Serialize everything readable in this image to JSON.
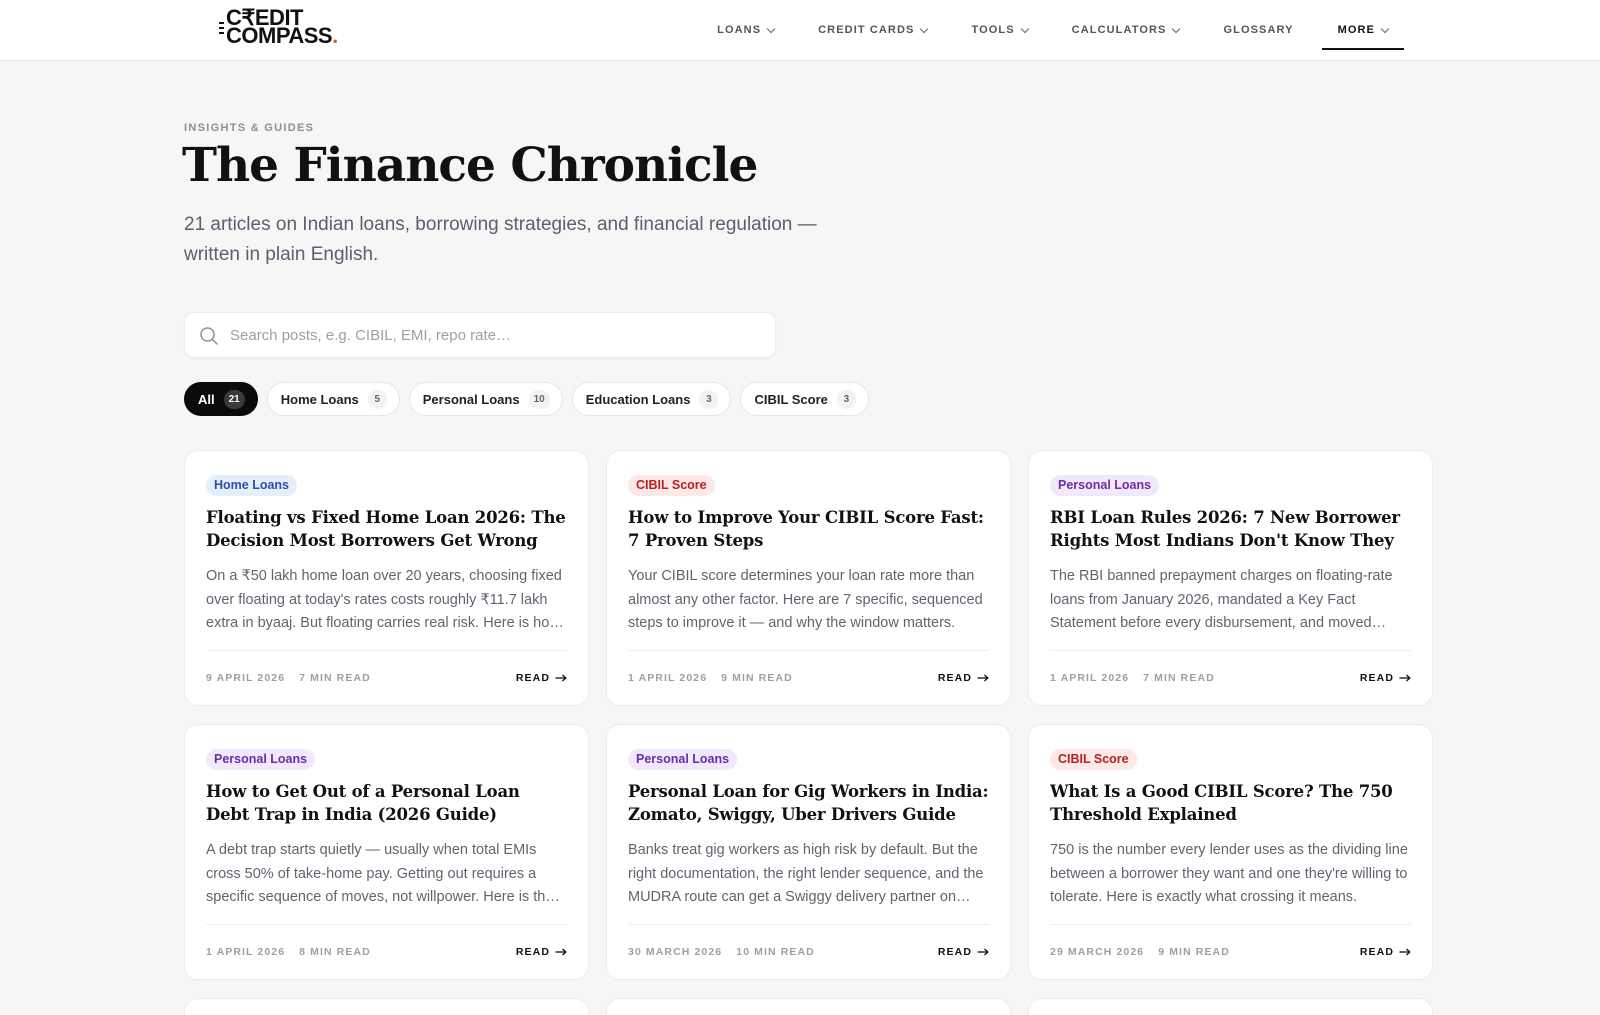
{
  "brand": {
    "logo_line1": "C₹EDIT",
    "logo_line2": "COMPASS",
    "logo_dot": ".",
    "accent": "#e8542a"
  },
  "nav": [
    {
      "label": "LOANS",
      "dropdown": true,
      "active": false
    },
    {
      "label": "CREDIT CARDS",
      "dropdown": true,
      "active": false
    },
    {
      "label": "TOOLS",
      "dropdown": true,
      "active": false
    },
    {
      "label": "CALCULATORS",
      "dropdown": true,
      "active": false
    },
    {
      "label": "GLOSSARY",
      "dropdown": false,
      "active": false
    },
    {
      "label": "MORE",
      "dropdown": true,
      "active": true
    }
  ],
  "hero": {
    "eyebrow": "INSIGHTS & GUIDES",
    "title": "The Finance Chronicle",
    "subtitle": "21 articles on Indian loans, borrowing strategies, and financial regulation — written in plain English."
  },
  "search": {
    "placeholder": "Search posts, e.g. CIBIL, EMI, repo rate…",
    "value": ""
  },
  "filters": [
    {
      "label": "All",
      "count": "21",
      "active": true
    },
    {
      "label": "Home Loans",
      "count": "5",
      "active": false
    },
    {
      "label": "Personal Loans",
      "count": "10",
      "active": false
    },
    {
      "label": "Education Loans",
      "count": "3",
      "active": false
    },
    {
      "label": "CIBIL Score",
      "count": "3",
      "active": false
    }
  ],
  "tag_colors": {
    "Home Loans": {
      "bg": "#e6eefc",
      "fg": "#2b4fa8"
    },
    "CIBIL Score": {
      "bg": "#fde8e8",
      "fg": "#b42323"
    },
    "Personal Loans": {
      "bg": "#f1e8fb",
      "fg": "#6a2fa8"
    }
  },
  "read_label": "READ",
  "articles": [
    {
      "tag": "Home Loans",
      "title": "Floating vs Fixed Home Loan 2026: The Decision Most Borrowers Get Wrong",
      "excerpt": "On a ₹50 lakh home loan over 20 years, choosing fixed over floating at today's rates costs roughly ₹11.7 lakh extra in byaaj. But floating carries real risk. Here is how to decide.",
      "date": "9 APRIL 2026",
      "read_time": "7 MIN READ"
    },
    {
      "tag": "CIBIL Score",
      "title": "How to Improve Your CIBIL Score Fast: 7 Proven Steps",
      "excerpt": "Your CIBIL score determines your loan rate more than almost any other factor. Here are 7 specific, sequenced steps to improve it — and why the window matters.",
      "date": "1 APRIL 2026",
      "read_time": "9 MIN READ"
    },
    {
      "tag": "Personal Loans",
      "title": "RBI Loan Rules 2026: 7 New Borrower Rights Most Indians Don't Know They Have",
      "excerpt": "The RBI banned prepayment charges on floating-rate loans from January 2026, mandated a Key Fact Statement before every disbursement, and moved more.",
      "date": "1 APRIL 2026",
      "read_time": "7 MIN READ"
    },
    {
      "tag": "Personal Loans",
      "title": "How to Get Out of a Personal Loan Debt Trap in India (2026 Guide)",
      "excerpt": "A debt trap starts quietly — usually when total EMIs cross 50% of take-home pay. Getting out requires a specific sequence of moves, not willpower. Here is the plan.",
      "date": "1 APRIL 2026",
      "read_time": "8 MIN READ"
    },
    {
      "tag": "Personal Loans",
      "title": "Personal Loan for Gig Workers in India: Zomato, Swiggy, Uber Drivers Guide 2026",
      "excerpt": "Banks treat gig workers as high risk by default. But the right documentation, the right lender sequence, and the MUDRA route can get a Swiggy delivery partner on board.",
      "date": "30 MARCH 2026",
      "read_time": "10 MIN READ"
    },
    {
      "tag": "CIBIL Score",
      "title": "What Is a Good CIBIL Score? The 750 Threshold Explained",
      "excerpt": "750 is the number every lender uses as the dividing line between a borrower they want and one they're willing to tolerate. Here is exactly what crossing it means.",
      "date": "29 MARCH 2026",
      "read_time": "9 MIN READ"
    }
  ]
}
